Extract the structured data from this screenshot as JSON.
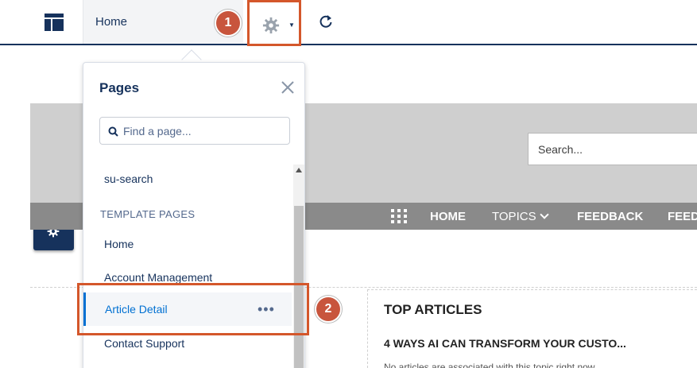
{
  "topbar": {
    "home_label": "Home",
    "icons": [
      "layout-icon",
      "gear-icon",
      "caret-down-icon",
      "refresh-icon"
    ]
  },
  "callouts": [
    "1",
    "2"
  ],
  "rail": {
    "icons": [
      "lightning-icon",
      "paintbrush-icon",
      "list-icon",
      "gear-icon"
    ]
  },
  "canvas": {
    "search_placeholder": "Search...",
    "nav": {
      "home": "HOME",
      "topics": "TOPICS",
      "feedback": "FEEDBACK",
      "feed_partial": "FEED"
    },
    "top_articles": "TOP ARTICLES",
    "article_title": "4 WAYS AI CAN TRANSFORM YOUR CUSTO...",
    "article_note": "No articles are associated with this topic right now."
  },
  "pages_panel": {
    "title": "Pages",
    "find_placeholder": "Find a page...",
    "items": {
      "su_search": "su-search",
      "section": "TEMPLATE PAGES",
      "home": "Home",
      "account_management": "Account Management",
      "article_detail": "Article Detail",
      "contact_support": "Contact Support"
    },
    "more_glyph": "•••"
  },
  "colors": {
    "brand_navy": "#16325c",
    "highlight_orange": "#d4572b",
    "callout_red": "#c8553d",
    "link_blue": "#0070d2"
  }
}
